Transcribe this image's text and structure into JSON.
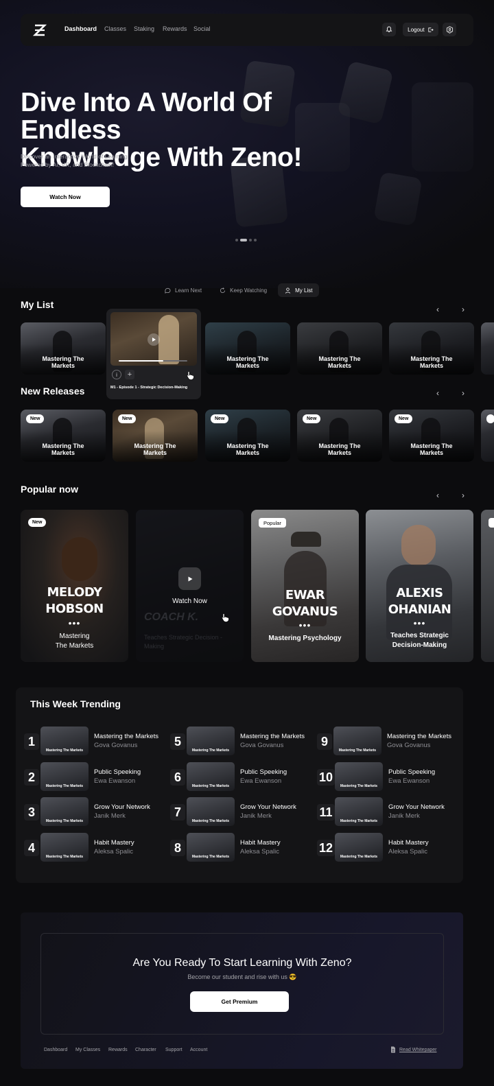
{
  "nav": {
    "links": [
      "Dashboard",
      "Classes",
      "Staking",
      "Rewards",
      "Social"
    ],
    "logout": "Logout"
  },
  "hero": {
    "title_line1": "Dive Into A World Of Endless",
    "title_line2": "Knowledge With Zeno!",
    "subtitle_line1": "Discover an Interactive World of Learning",
    "subtitle_line2": "Powered by AI, VR, and Blockchain!",
    "cta": "Watch Now"
  },
  "tabs": [
    "Learn Next",
    "Keep Watching",
    "My List"
  ],
  "my_list": {
    "title": "My List",
    "card_label_1": "Mastering The",
    "card_label_2": "Markets",
    "hover": {
      "episode": "M1 - Episode 1 -  Strategic Decision-Making",
      "progress": 0.65
    }
  },
  "new_releases": {
    "title": "New Releases",
    "badge": "New",
    "card_label_1": "Mastering The",
    "card_label_2": "Markets"
  },
  "popular": {
    "title": "Popular now",
    "cards": [
      {
        "badge": "New",
        "name1": "MELODY",
        "name2": "HOBSON",
        "sub1": "Mastering",
        "sub2": "The Markets"
      },
      {
        "watch": "Watch Now",
        "name": "COACH K.",
        "sub1": "Teaches Strategic Decision -",
        "sub2": "Making"
      },
      {
        "badge": "Popular",
        "name1": "EWAR",
        "name2": "GOVANUS",
        "sub1": "Mastering Psychology"
      },
      {
        "name1": "ALEXIS",
        "name2": "OHANIAN",
        "sub1": "Teaches Strategic",
        "sub2": "Decision-Making"
      }
    ],
    "ellipsis": "•••"
  },
  "trending": {
    "title": "This Week Trending",
    "thumb_label": "Mastering The Markets",
    "items": [
      {
        "rank": "1",
        "title": "Mastering the Markets",
        "author": "Gova Govanus"
      },
      {
        "rank": "2",
        "title": "Public Speeking",
        "author": "Ewa Ewanson"
      },
      {
        "rank": "3",
        "title": "Grow Your Network",
        "author": "Janik Merk"
      },
      {
        "rank": "4",
        "title": "Habit Mastery",
        "author": "Aleksa Spalic"
      },
      {
        "rank": "5",
        "title": "Mastering the Markets",
        "author": "Gova Govanus"
      },
      {
        "rank": "6",
        "title": "Public Speeking",
        "author": "Ewa Ewanson"
      },
      {
        "rank": "7",
        "title": "Grow Your Network",
        "author": "Janik Merk"
      },
      {
        "rank": "8",
        "title": "Habit Mastery",
        "author": "Aleksa Spalic"
      },
      {
        "rank": "9",
        "title": "Mastering the Markets",
        "author": "Gova Govanus"
      },
      {
        "rank": "10",
        "title": "Public Speeking",
        "author": "Ewa Ewanson"
      },
      {
        "rank": "11",
        "title": "Grow Your Network",
        "author": "Janik Merk"
      },
      {
        "rank": "12",
        "title": "Habit Mastery",
        "author": "Aleksa Spalic"
      }
    ]
  },
  "cta": {
    "title": "Are You Ready To Start Learning With Zeno?",
    "subtitle": "Become our student and rise with us 😎",
    "button": "Get Premium"
  },
  "footer": {
    "links": [
      "Dashboard",
      "My Classes",
      "Rewards",
      "Character",
      "Support",
      "Account"
    ],
    "whitepaper": "Read Whitepaper"
  }
}
